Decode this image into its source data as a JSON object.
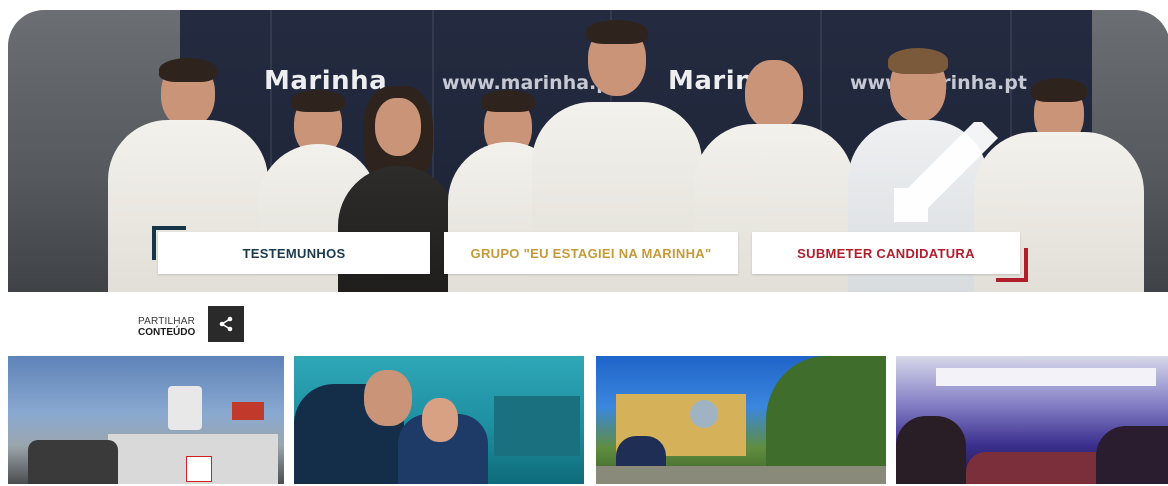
{
  "hero": {
    "backdrop_logo_text": "Marinha",
    "backdrop_url_text": "www.marinha.pt",
    "buttons": {
      "testemunhos": "TESTEMUNHOS",
      "grupo": "GRUPO \"EU ESTAGIEI NA MARINHA\"",
      "submeter": "SUBMETER CANDIDATURA"
    }
  },
  "share": {
    "line1": "PARTILHAR",
    "line2": "CONTEÚDO",
    "icon": "share-icon"
  },
  "thumbnails": [
    {
      "name": "ship-deck-photo",
      "icon": "photo"
    },
    {
      "name": "aquarium-lab-photo",
      "icon": "photo"
    },
    {
      "name": "aquarium-building-photo",
      "icon": "photo"
    },
    {
      "name": "coral-tank-photo",
      "icon": "photo"
    }
  ],
  "colors": {
    "navy": "#1d3a4d",
    "gold": "#c59a3a",
    "red": "#b01e2d"
  }
}
